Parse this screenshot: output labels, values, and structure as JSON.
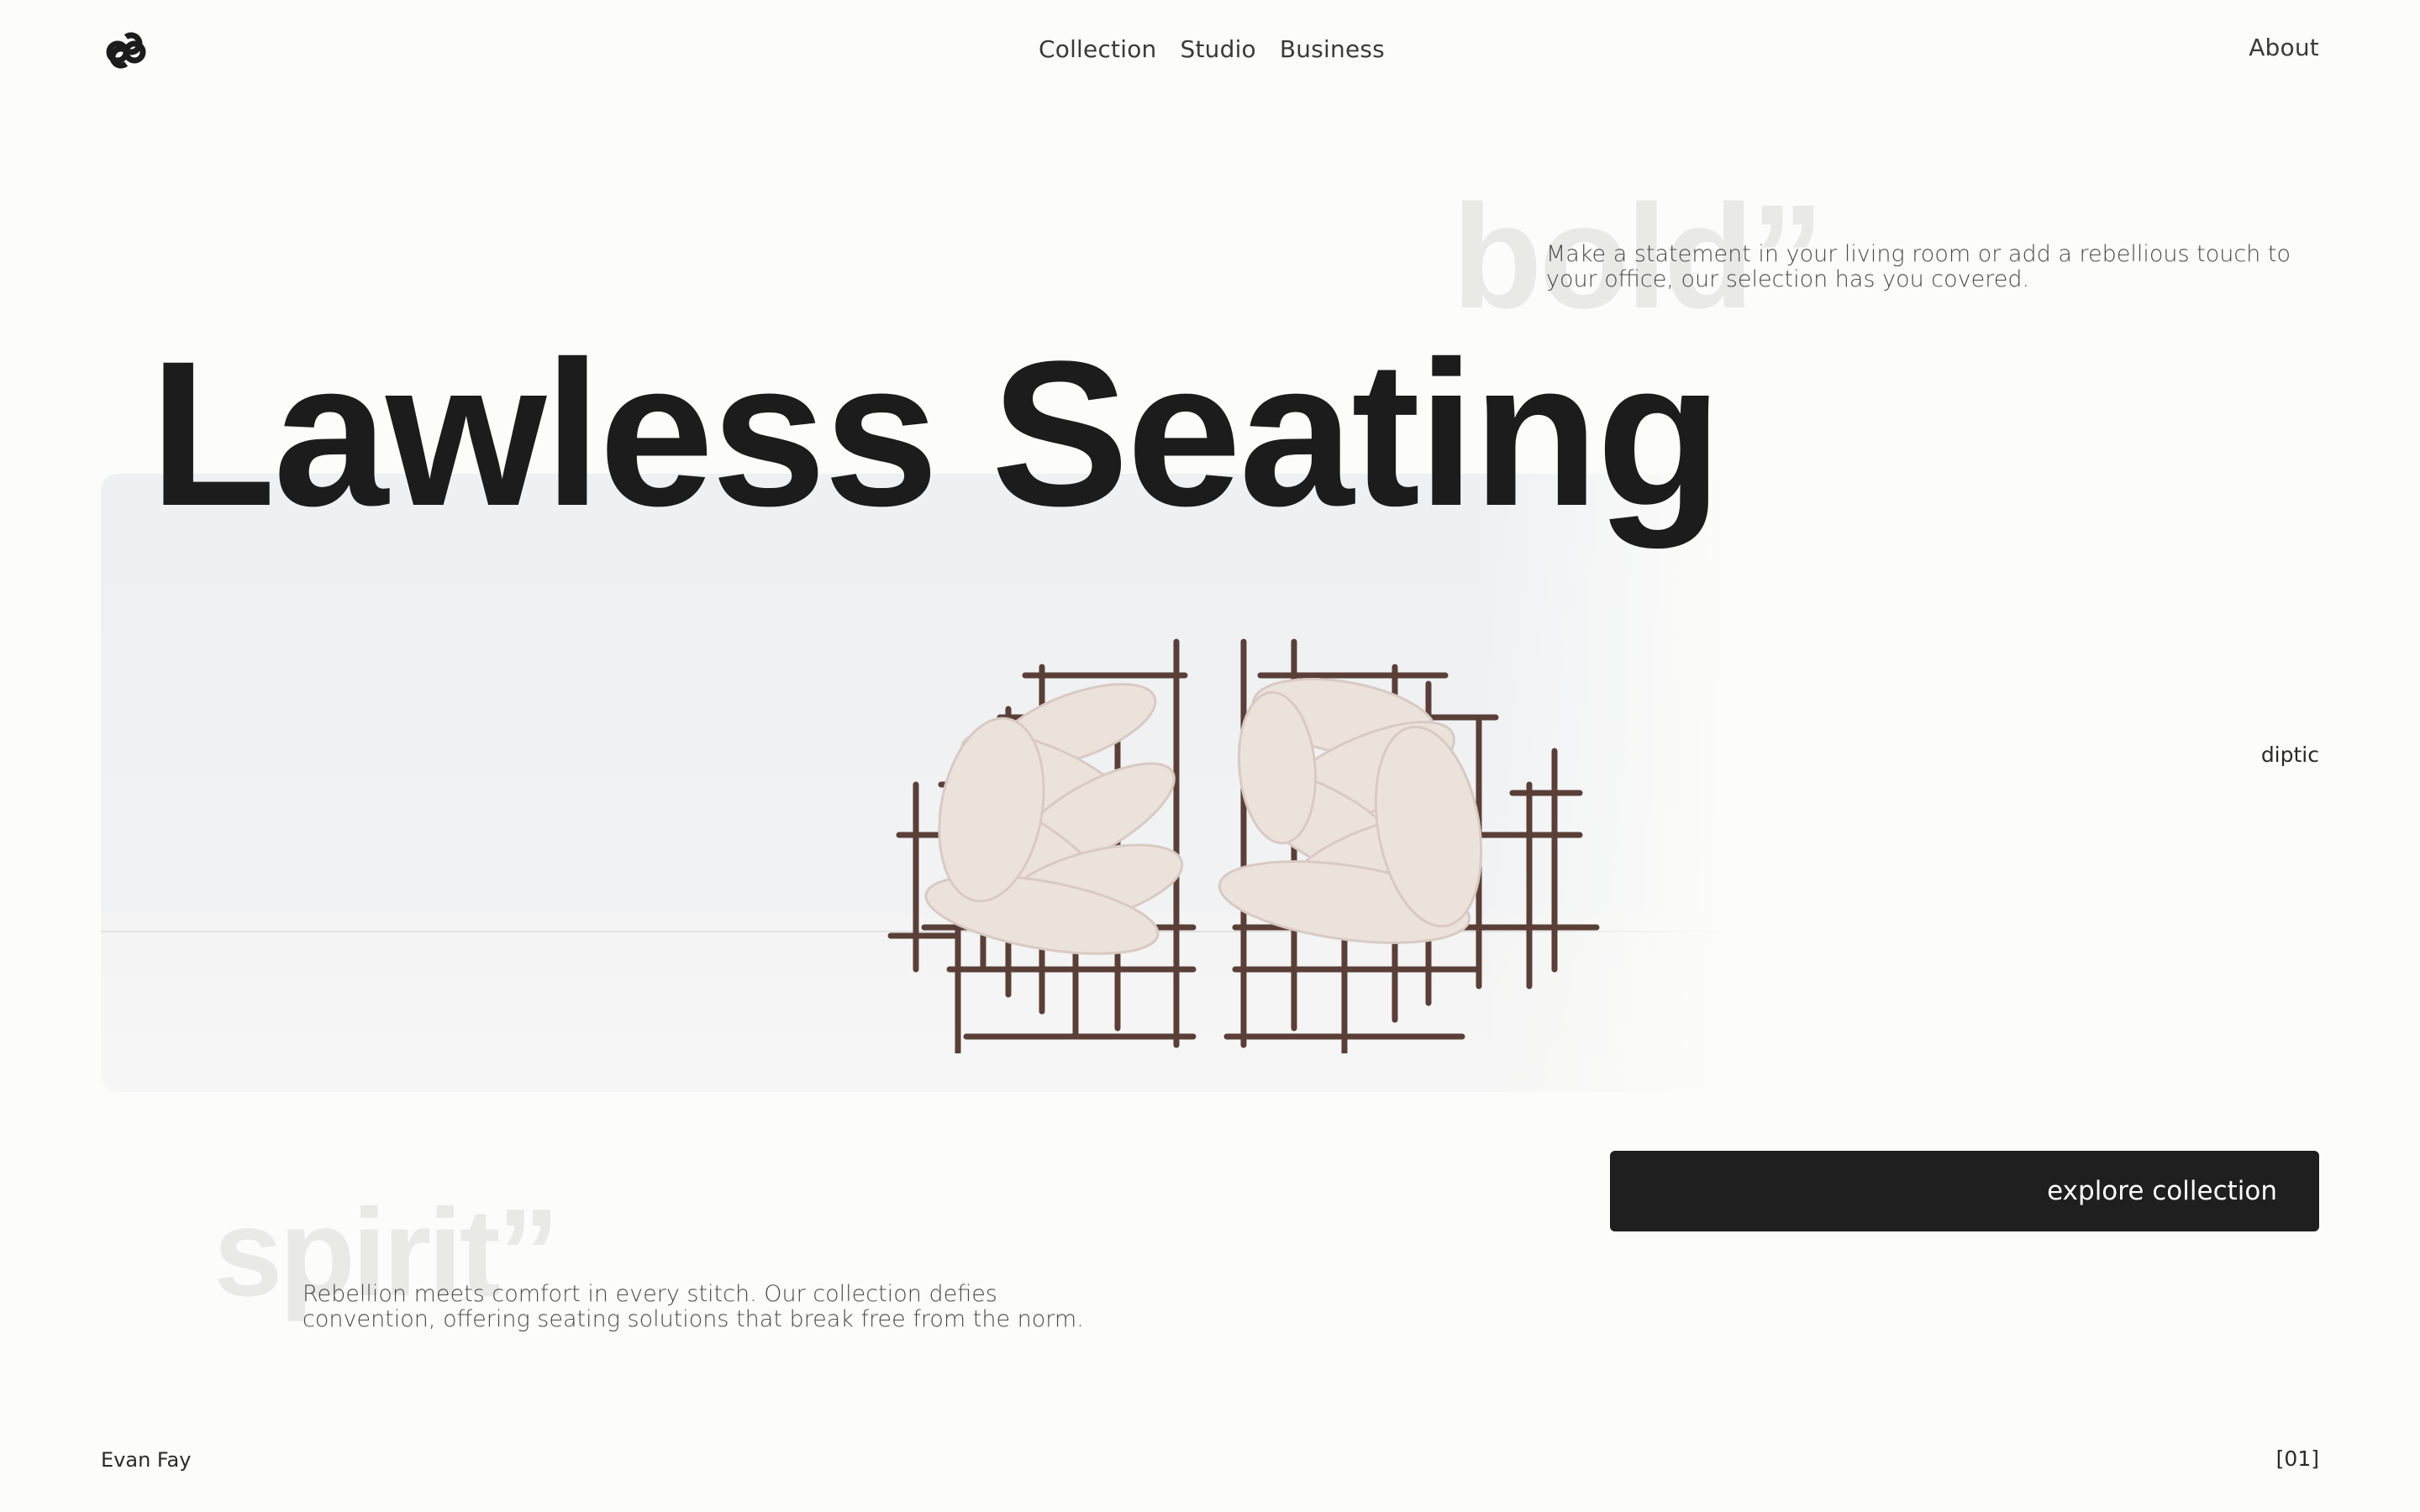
{
  "header": {
    "logo_icon": "interlocking-rings-logo-icon",
    "nav": [
      {
        "label": "Collection"
      },
      {
        "label": "Studio"
      },
      {
        "label": "Business"
      }
    ],
    "about_label": "About"
  },
  "hero": {
    "ghost_top": "bold”",
    "description_top": "Make a statement in your living room or add a rebellious touch to your office, our selection has you covered.",
    "title": "Lawless Seating",
    "brand_tag": "diptic",
    "image_subject": "two-knotted-cushion-chairs-image"
  },
  "cta": {
    "label": "explore collection"
  },
  "section": {
    "ghost_bottom": "spirit”",
    "description_bottom": "Rebellion meets comfort in every stitch. Our collection defies convention, offering seating solutions that break free from the norm."
  },
  "footer": {
    "name": "Evan Fay",
    "page_indicator": "[01]"
  },
  "colors": {
    "background": "#fcfcfa",
    "text_dark": "#1c1c1c",
    "cta_bg": "#1f1f1f",
    "ghost_text": "#e9e9e6",
    "chair_frame": "#5a3f38",
    "chair_cushion": "#ece2dc"
  }
}
